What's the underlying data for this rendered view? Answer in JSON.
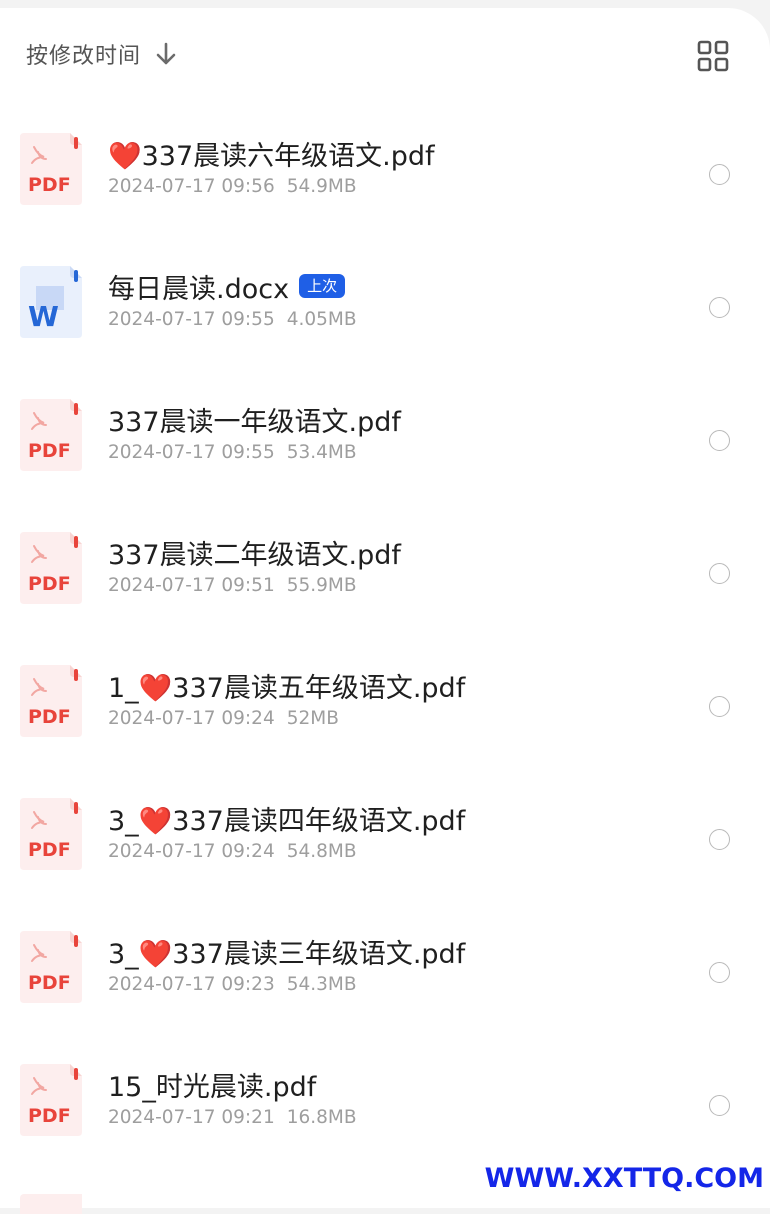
{
  "toolbar": {
    "sort_label": "按修改时间",
    "sort_icon": "arrow-down-icon",
    "view_icon": "grid-view-icon"
  },
  "colors": {
    "pdf_red": "#e8443b",
    "word_blue": "#2567d6",
    "badge_blue": "#1f5fe6"
  },
  "files": [
    {
      "name": "❤️337晨读六年级语文.pdf",
      "date": "2024-07-17 09:56",
      "size": "54.9MB",
      "type": "pdf",
      "badge": ""
    },
    {
      "name": "每日晨读.docx",
      "date": "2024-07-17 09:55",
      "size": "4.05MB",
      "type": "docx",
      "badge": "上次"
    },
    {
      "name": "337晨读一年级语文.pdf",
      "date": "2024-07-17 09:55",
      "size": "53.4MB",
      "type": "pdf",
      "badge": ""
    },
    {
      "name": "337晨读二年级语文.pdf",
      "date": "2024-07-17 09:51",
      "size": "55.9MB",
      "type": "pdf",
      "badge": ""
    },
    {
      "name": "1_❤️337晨读五年级语文.pdf",
      "date": "2024-07-17 09:24",
      "size": "52MB",
      "type": "pdf",
      "badge": ""
    },
    {
      "name": "3_❤️337晨读四年级语文.pdf",
      "date": "2024-07-17 09:24",
      "size": "54.8MB",
      "type": "pdf",
      "badge": ""
    },
    {
      "name": "3_❤️337晨读三年级语文.pdf",
      "date": "2024-07-17 09:23",
      "size": "54.3MB",
      "type": "pdf",
      "badge": ""
    },
    {
      "name": "15_时光晨读.pdf",
      "date": "2024-07-17 09:21",
      "size": "16.8MB",
      "type": "pdf",
      "badge": ""
    }
  ],
  "pdf_icon_label": "PDF",
  "word_icon_label": "W",
  "watermark": "WWW.XXTTQ.COM"
}
